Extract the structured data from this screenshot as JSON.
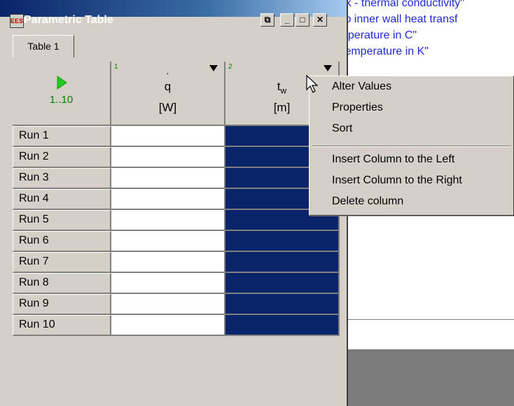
{
  "background_editor": {
    "lines": [
      "\"k - thermal conductivity\"",
      "to inner wall heat transf",
      "nperature in C\"",
      "temperature in K\""
    ]
  },
  "window": {
    "title": "Parametric Table",
    "icon_text": "EES",
    "buttons": [
      "clipboard",
      "minimize",
      "maximize",
      "close"
    ]
  },
  "tabs": [
    "Table 1"
  ],
  "table": {
    "run_header": {
      "icon": "play-icon",
      "range": "1..10"
    },
    "columns": [
      {
        "number": "1",
        "name": "q",
        "accent": "·",
        "unit": "[W]"
      },
      {
        "number": "2",
        "name": "t",
        "subscript": "w",
        "unit": "[m]"
      }
    ],
    "rows": [
      "Run 1",
      "Run 2",
      "Run 3",
      "Run 4",
      "Run 5",
      "Run 6",
      "Run 7",
      "Run 8",
      "Run 9",
      "Run 10"
    ]
  },
  "context_menu": {
    "group1": [
      "Alter Values",
      "Properties",
      "Sort"
    ],
    "group2": [
      "Insert Column to the Left",
      "Insert Column to the Right",
      "Delete column"
    ]
  },
  "colors": {
    "selected_column": "#0a246a",
    "background_text": "#1f2bd6",
    "play": "#22cc22"
  }
}
